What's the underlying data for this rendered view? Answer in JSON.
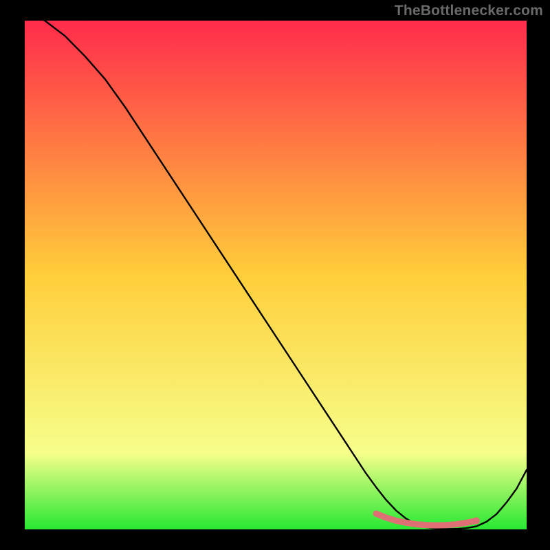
{
  "watermark": "TheBottlenecker.com",
  "chart_data": {
    "type": "line",
    "title": "",
    "xlabel": "",
    "ylabel": "",
    "xlim": [
      0,
      100
    ],
    "ylim": [
      0,
      100
    ],
    "grid": false,
    "legend": false,
    "background_gradient": {
      "top": "#ff2b4b",
      "mid": "#ffce3a",
      "low": "#f6ff8a",
      "bottom": "#27e833"
    },
    "series": [
      {
        "name": "bottleneck-curve",
        "color": "#000000",
        "x": [
          0,
          4,
          8,
          12,
          16,
          20,
          24,
          28,
          32,
          36,
          40,
          44,
          48,
          52,
          56,
          60,
          64,
          68,
          70,
          72,
          74,
          76,
          78,
          80,
          82,
          84,
          86,
          88,
          90,
          92,
          94,
          96,
          98,
          100
        ],
        "y": [
          102,
          100,
          97,
          93,
          88.5,
          83,
          77,
          71,
          65,
          59,
          53,
          47,
          41,
          35,
          29,
          23,
          17,
          11,
          8.3,
          5.8,
          3.7,
          2.1,
          1.0,
          0.4,
          0.15,
          0.08,
          0.1,
          0.25,
          0.6,
          1.5,
          3.0,
          5.3,
          8.0,
          11.7
        ]
      },
      {
        "name": "highlight-band",
        "color": "#de6f74",
        "x": [
          70,
          72,
          74,
          76,
          78,
          80,
          82,
          84,
          86,
          88,
          90
        ],
        "y": [
          3.1,
          2.3,
          1.7,
          1.3,
          1.0,
          0.85,
          0.8,
          0.85,
          1.0,
          1.3,
          1.7
        ]
      }
    ],
    "highlight_dot": {
      "x": 90,
      "y": 1.7,
      "color": "#de6f74"
    }
  }
}
